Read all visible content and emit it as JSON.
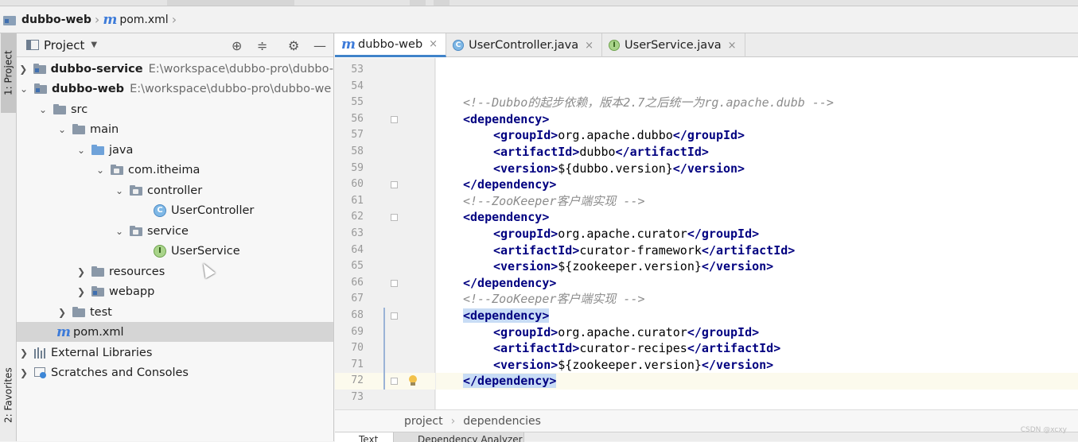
{
  "breadcrumb": {
    "project": "dubbo-web",
    "file": "pom.xml"
  },
  "left_stripe": {
    "project_tab": "1: Project",
    "favorites_tab": "2: Favorites"
  },
  "project_panel": {
    "title": "Project",
    "icons": [
      "locate-icon",
      "collapse-icon",
      "gear-icon",
      "minimize-icon"
    ],
    "tree": [
      {
        "label": "dubbo-service",
        "path": "E:\\workspace\\dubbo-pro\\dubbo-",
        "bold": true
      },
      {
        "label": "dubbo-web",
        "path": "E:\\workspace\\dubbo-pro\\dubbo-we",
        "bold": true
      },
      {
        "label": "src"
      },
      {
        "label": "main"
      },
      {
        "label": "java"
      },
      {
        "label": "com.itheima"
      },
      {
        "label": "controller"
      },
      {
        "label": "UserController"
      },
      {
        "label": "service"
      },
      {
        "label": "UserService"
      },
      {
        "label": "resources"
      },
      {
        "label": "webapp"
      },
      {
        "label": "test"
      },
      {
        "label": "pom.xml"
      },
      {
        "label": "External Libraries"
      },
      {
        "label": "Scratches and Consoles"
      }
    ]
  },
  "editor": {
    "tabs": [
      {
        "label": "dubbo-web",
        "type": "maven",
        "active": true
      },
      {
        "label": "UserController.java",
        "type": "class"
      },
      {
        "label": "UserService.java",
        "type": "interface"
      }
    ],
    "tab_close": "×",
    "lines": [
      {
        "n": "53",
        "code": ""
      },
      {
        "n": "54",
        "code": ""
      },
      {
        "n": "55",
        "comment": "<!--Dubbo的起步依赖，版本2.7之后统一为rg.apache.dubb -->"
      },
      {
        "n": "56",
        "tag": "<dependency>"
      },
      {
        "n": "57",
        "open": "<groupId>",
        "text": "org.apache.dubbo",
        "close": "</groupId>"
      },
      {
        "n": "58",
        "open": "<artifactId>",
        "text": "dubbo",
        "close": "</artifactId>"
      },
      {
        "n": "59",
        "open": "<version>",
        "text": "${dubbo.version}",
        "close": "</version>"
      },
      {
        "n": "60",
        "tag": "</dependency>"
      },
      {
        "n": "61",
        "comment": "<!--ZooKeeper客户端实现 -->"
      },
      {
        "n": "62",
        "tag": "<dependency>"
      },
      {
        "n": "63",
        "open": "<groupId>",
        "text": "org.apache.curator",
        "close": "</groupId>"
      },
      {
        "n": "64",
        "open": "<artifactId>",
        "text": "curator-framework",
        "close": "</artifactId>"
      },
      {
        "n": "65",
        "open": "<version>",
        "text": "${zookeeper.version}",
        "close": "</version>"
      },
      {
        "n": "66",
        "tag": "</dependency>"
      },
      {
        "n": "67",
        "comment": "<!--ZooKeeper客户端实现 -->"
      },
      {
        "n": "68",
        "tag": "<dependency>"
      },
      {
        "n": "69",
        "open": "<groupId>",
        "text": "org.apache.curator",
        "close": "</groupId>"
      },
      {
        "n": "70",
        "open": "<artifactId>",
        "text": "curator-recipes",
        "close": "</artifactId>"
      },
      {
        "n": "71",
        "open": "<version>",
        "text": "${zookeeper.version}",
        "close": "</version>"
      },
      {
        "n": "72",
        "tag": "</dependency>"
      },
      {
        "n": "73",
        "code": ""
      }
    ],
    "breadcrumb": [
      "project",
      "dependencies"
    ],
    "bottom_tabs": [
      "Text",
      "Dependency Analyzer"
    ]
  },
  "watermark": "CSDN @xcxy"
}
